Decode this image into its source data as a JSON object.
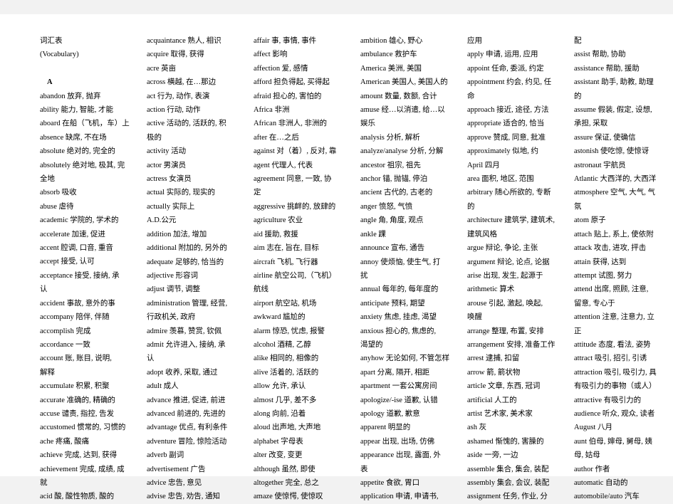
{
  "document": {
    "title": "词汇表",
    "subtitle": "(Vocabulary)",
    "section_letter": "A",
    "background_color": "#f2f2f2",
    "page_color": "#ffffff",
    "text_color": "#000000"
  },
  "columns": [
    {
      "id": "column-1",
      "entries": [
        "词汇表",
        "(Vocabulary)",
        "",
        "A",
        "abandon  放弃, 抛弃",
        "ability  能力, 智能, 才能",
        "aboard 在船（飞机，车）上",
        "absence  缺席, 不在场",
        "absolute 绝对的, 完全的",
        "absolutely 绝对地, 极其, 完",
        "全地",
        "absorb 吸收",
        "abuse  虐待",
        "academic 学院的, 学术的",
        "accelerate 加速, 促进",
        "accent 腔调, 口音, 重音",
        "accept 接受, 认可",
        "acceptance  接受, 接纳, 承",
        "认",
        "accident 事故, 意外的事",
        "accompany  陪伴, 伴随",
        "accomplish 完成",
        "accordance 一致",
        "account  账, 账目, 说明,",
        "解释",
        "accumulate 积累, 积聚",
        "accurate 准确的, 精确的",
        "accuse 谴责, 指控, 告发",
        "accustomed 惯常的, 习惯的",
        "ache 疼痛, 酸痛",
        "achieve  完成, 达到, 获得",
        "achievement 完成, 成绩, 成",
        "就",
        "acid 酸, 酸性物质, 酸的"
      ]
    },
    {
      "id": "column-2",
      "entries": [
        "acquaintance 熟人, 相识",
        "acquire  取得, 获得",
        "acre 英亩",
        "across 横越, 在…那边",
        "act  行为, 动作, 表演",
        "action 行动, 动作",
        "active 活动的, 活跃的, 积",
        "极的",
        "activity 活动",
        "actor  男演员",
        "actress  女演员",
        "actual 实际的, 现实的",
        "actually 实际上",
        "A.D.公元",
        "addition 加法, 增加",
        "additional 附加的, 另外的",
        "adequate 足够的, 恰当的",
        "adjective  形容词",
        "adjust 调节, 调整",
        "administration 管理, 经营,",
        "行政机关, 政府",
        "admire 羡慕, 赞赏, 钦佩",
        "admit  允许进入, 接纳, 承",
        "认",
        "adopt  收养, 采取, 通过",
        "adult  成人",
        "advance  推进, 促进, 前进",
        "advanced 前进的, 先进的",
        "advantage  优点, 有利条件",
        "adventure  冒险, 惊险活动",
        "adverb 副词",
        "advertisement  广告",
        "advice 忠告, 意见",
        "advise 忠告, 劝告, 通知"
      ]
    },
    {
      "id": "column-3",
      "entries": [
        "affair 事, 事情, 事件",
        "affect 影响",
        "affection  爱, 感情",
        "afford 担负得起, 买得起",
        "afraid 担心的, 害怕的",
        "Africa 非洲",
        "African  非洲人, 非洲的",
        "after  在…之后",
        "against  对（着）, 反对, 靠",
        "agent  代理人, 代表",
        "agreement  同意, 一致, 协",
        "定",
        "aggressive 挑衅的, 放肆的",
        "agriculture  农业",
        "aid  援助, 救援",
        "aim  志在, 旨在, 目标",
        "aircraft 飞机, 飞行器",
        "airline  航空公司,（飞机）",
        "航线",
        "airport  航空站, 机场",
        "awkward  尴尬的",
        "alarm  惊恐, 忧虑, 报警",
        "alcohol  酒精, 乙醇",
        "alike  相同的, 相像的",
        "alive  活着的, 活跃的",
        "allow  允许,  承认",
        "almost 几乎, 差不多",
        "along  向前, 沿着",
        "aloud  出声地, 大声地",
        "alphabet 字母表",
        "alter  改变, 变更",
        "although 虽然, 即使",
        "altogether 完全, 总之",
        "amaze  使惊愕, 使惊叹"
      ]
    },
    {
      "id": "column-4",
      "entries": [
        "ambition 雄心, 野心",
        "ambulance  救护车",
        "America  美洲, 美国",
        "American 美国人, 美国人的",
        "amount 数量, 数额, 合计",
        "amuse  经…以消遣, 给…以",
        "娱乐",
        "analysis 分析, 解析",
        "analyze/analyse  分析, 分解",
        "ancestor 祖宗, 祖先",
        "anchor 锚, 抛锚, 停泊",
        "ancient  古代的, 古老的",
        "anger  愤怒, 气愤",
        "angle  角, 角度, 观点",
        "ankle  踝",
        "announce 宣布, 通告",
        "annoy  使烦恼, 使生气, 打",
        "扰",
        "annual 每年的, 每年度的",
        "anticipate 预料, 期望",
        "anxiety  焦虑, 挂虑, 渴望",
        "anxious  担心的, 焦虑的,",
        "渴望的",
        "anyhow 无论如何, 不管怎样",
        "apart  分离, 隔开, 相距",
        "apartment  一套公寓房间",
        "apologize/-ise 道歉, 认错",
        "apology  道歉, 歉意",
        "apparent 明显的",
        "appear 出现, 出场, 仿佛",
        "appearance  出现, 露面, 外",
        "表",
        "appetite 食欲, 胃口",
        "application  申请, 申请书,"
      ]
    },
    {
      "id": "column-5",
      "entries": [
        "应用",
        "apply  申请, 运用, 应用",
        "appoint  任命, 委派, 约定",
        "appointment  约会, 约见, 任",
        "命",
        "approach 接近, 途径, 方法",
        "appropriate  适合的, 恰当",
        "approve  赞成, 同意, 批准",
        "approximately  似地, 约",
        "April  四月",
        "area 面积, 地区, 范围",
        "arbitrary  随心所欲的, 专断",
        "的",
        "architecture 建筑学, 建筑术,",
        "建筑风格",
        "argue  辩论, 争论, 主张",
        "argument 辩论, 论点, 论据",
        "arise  出现, 发生, 起源于",
        "arithmetic 算术",
        "arouse  引起, 激起, 唤起,",
        "唤醒",
        "arrange  整理, 布置, 安排",
        "arrangement  安排, 准备工作",
        "arrest 逮捕, 扣留",
        "arrow  箭, 箭状物",
        "article  文章, 东西, 冠词",
        "artificial 人工的",
        "artist 艺术家, 美术家",
        "ash  灰",
        "ashamed  惭愧的, 害臊的",
        "aside  一旁, 一边",
        "assemble 集合, 集会, 装配",
        "assembly 集会, 会议, 装配",
        "assignment 任务, 作业, 分"
      ]
    },
    {
      "id": "column-6",
      "entries": [
        "配",
        "assist 帮助, 协助",
        "assistance 帮助, 援助",
        "assistant  助手, 助教, 助理",
        "的",
        "assume 假装, 假定, 设想,",
        "承担, 采取",
        "assure 保证, 使确信",
        "astonish 使吃惊, 使惊讶",
        "astronaut  宇航员",
        "Atlantic 大西洋的, 大西洋",
        "atmosphere 空气, 大气, 气",
        "氛",
        "atom 原子",
        "attach 贴上, 系上, 使依附",
        "attack 攻击, 进攻, 抨击",
        "attain 获得, 达到",
        "attempt  试图, 努力",
        "attend  出席, 照顾, 注意,",
        "留意, 专心于",
        "attention  注意, 注意力, 立",
        "正",
        "attitude 态度, 看法, 姿势",
        "attract  吸引, 招引, 引诱",
        "attraction 吸引, 吸引力, 具",
        "有吸引力的事物（或人）",
        "attractive 有吸引力的",
        "audience 听众, 观众, 读者",
        "August 八月",
        "aunt 伯母, 婶母, 舅母, 姨",
        "母, 姑母",
        "author 作者",
        "automatic  自动的",
        "automobile/auto  汽车"
      ]
    }
  ]
}
